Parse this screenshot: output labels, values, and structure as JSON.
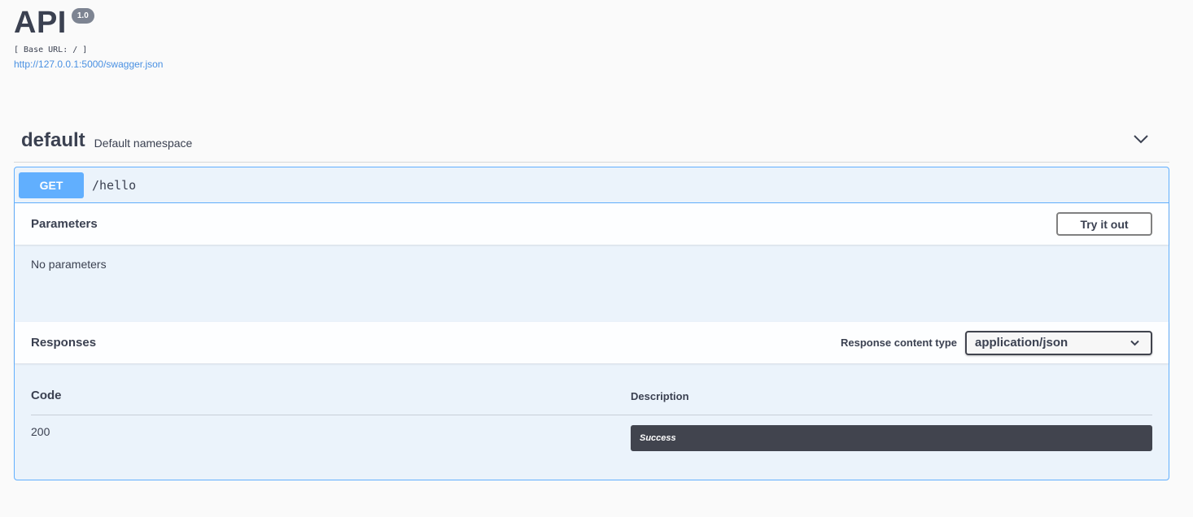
{
  "info": {
    "title": "API",
    "version": "1.0",
    "base_url": "[ Base URL: / ]",
    "spec_link": "http://127.0.0.1:5000/swagger.json"
  },
  "tag": {
    "name": "default",
    "description": "Default namespace",
    "toggle_icon": "chevron-down-icon"
  },
  "operation": {
    "method": "GET",
    "path": "/hello",
    "colors": {
      "method_bg": "#61affe",
      "block_bg": "#ebf3fb"
    }
  },
  "parameters": {
    "title": "Parameters",
    "try_label": "Try it out",
    "empty_text": "No parameters"
  },
  "responses": {
    "title": "Responses",
    "content_type_label": "Response content type",
    "content_type_value": "application/json",
    "headers": {
      "code": "Code",
      "description": "Description"
    },
    "rows": [
      {
        "code": "200",
        "description": "Success"
      }
    ]
  }
}
